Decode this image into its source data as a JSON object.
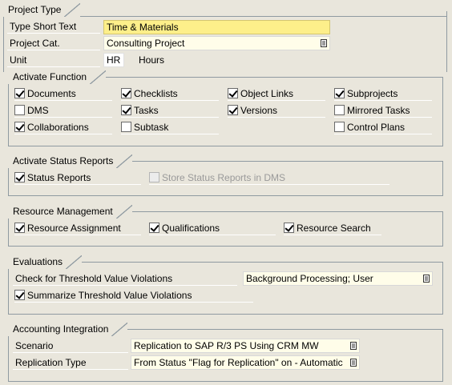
{
  "project_type": {
    "title": "Project Type",
    "type_short_text_label": "Type Short Text",
    "type_short_text_value": "Time & Materials",
    "project_cat_label": "Project Cat.",
    "project_cat_value": "Consulting Project",
    "unit_label": "Unit",
    "unit_value": "HR",
    "unit_text": "Hours"
  },
  "activate_function": {
    "title": "Activate Function",
    "items": [
      {
        "label": "Documents",
        "checked": true
      },
      {
        "label": "Checklists",
        "checked": true
      },
      {
        "label": "Object Links",
        "checked": true
      },
      {
        "label": "Subprojects",
        "checked": true
      },
      {
        "label": "DMS",
        "checked": false
      },
      {
        "label": "Tasks",
        "checked": true
      },
      {
        "label": "Versions",
        "checked": true
      },
      {
        "label": "Mirrored Tasks",
        "checked": false
      },
      {
        "label": "Collaborations",
        "checked": true
      },
      {
        "label": "Subtask",
        "checked": false
      },
      {
        "label": "Control Plans",
        "checked": false
      }
    ]
  },
  "status_reports": {
    "title": "Activate Status Reports",
    "status_reports_label": "Status Reports",
    "status_reports_checked": true,
    "store_dms_label": "Store Status Reports in DMS",
    "store_dms_checked": false
  },
  "resource_management": {
    "title": "Resource Management",
    "assignment_label": "Resource Assignment",
    "qualifications_label": "Qualifications",
    "search_label": "Resource Search"
  },
  "evaluations": {
    "title": "Evaluations",
    "threshold_label": "Check for Threshold Value Violations",
    "threshold_value": "Background Processing; User",
    "summarize_label": "Summarize Threshold Value Violations"
  },
  "accounting": {
    "title": "Accounting Integration",
    "scenario_label": "Scenario",
    "scenario_value": "Replication to SAP R/3 PS Using CRM MW",
    "replication_label": "Replication Type",
    "replication_value": "From Status \"Flag for Replication\" on - Automatic"
  }
}
